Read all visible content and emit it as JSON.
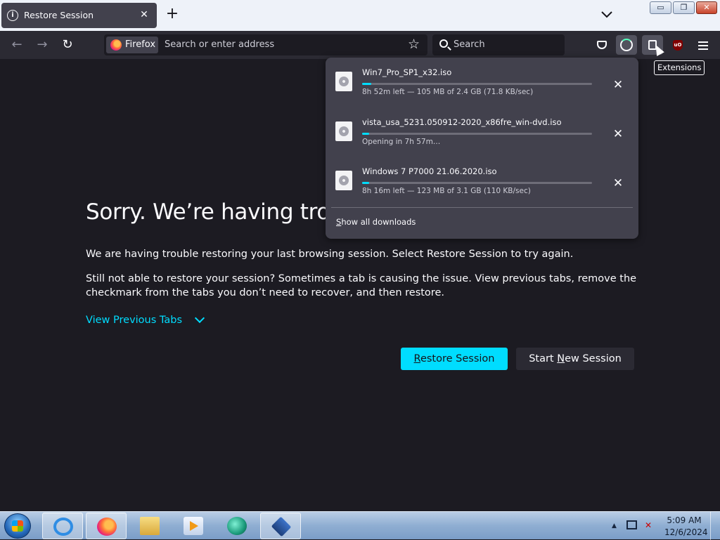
{
  "browser": {
    "tab": {
      "title": "Restore Session"
    },
    "new_tab_glyph": "+",
    "close_glyph": "✕",
    "window_buttons": {
      "minimize": "▭",
      "maximize": "❐",
      "close": "✕"
    },
    "nav": {
      "back": "←",
      "forward": "→",
      "reload": "↻"
    },
    "identity_label": "Firefox",
    "address_placeholder": "Search or enter address",
    "search_placeholder": "Search",
    "bookmark_star": "☆",
    "ublock_label": "uO",
    "tooltip": "Extensions",
    "icons": [
      "info-icon",
      "close-icon",
      "plus-icon",
      "chevron-down-icon",
      "back-arrow-icon",
      "forward-arrow-icon",
      "reload-icon",
      "firefox-logo-icon",
      "star-icon",
      "search-icon",
      "pocket-icon",
      "downloads-icon",
      "extensions-icon",
      "ublock-icon",
      "hamburger-menu-icon"
    ]
  },
  "page": {
    "title": "Sorry. We’re having troub",
    "paragraph1": "We are having trouble restoring your last browsing session. Select Restore Session to try again.",
    "paragraph2": "Still not able to restore your session? Sometimes a tab is causing the issue. View previous tabs, remove the checkmark from the tabs you don’t need to recover, and then restore.",
    "view_tabs": "View Previous Tabs",
    "restore_button": {
      "pre": "",
      "accel": "R",
      "post": "estore Session"
    },
    "new_session_button": {
      "pre": "Start ",
      "accel": "N",
      "post": "ew Session"
    }
  },
  "downloads": {
    "items": [
      {
        "name": "Win7_Pro_SP1_x32.iso",
        "status": "8h 52m left — 105 MB of 2.4 GB (71.8 KB/sec)",
        "progress": 0.04
      },
      {
        "name": "vista_usa_5231.050912-2020_x86fre_win-dvd.iso",
        "status": "Opening in 7h 57m…",
        "progress": 0.03
      },
      {
        "name": "Windows 7 P7000 21.06.2020.iso",
        "status": "8h 16m left — 123 MB of 3.1 GB (110 KB/sec)",
        "progress": 0.03
      }
    ],
    "cancel_glyph": "✕",
    "show_all": "Show all downloads",
    "show_all_accel": "S",
    "show_all_rest": "how all downloads"
  },
  "taskbar": {
    "apps": [
      "internet-explorer",
      "firefox",
      "file-explorer",
      "media-player",
      "app-round",
      "virtualbox"
    ],
    "tray_arrow": "▲",
    "volume_glyph": "✕",
    "time": "5:09 AM",
    "date": "12/6/2024"
  },
  "colors": {
    "accent": "#00ddff",
    "panel": "#42414d",
    "page_bg": "#1c1b22",
    "toolbar": "#2b2a33"
  }
}
